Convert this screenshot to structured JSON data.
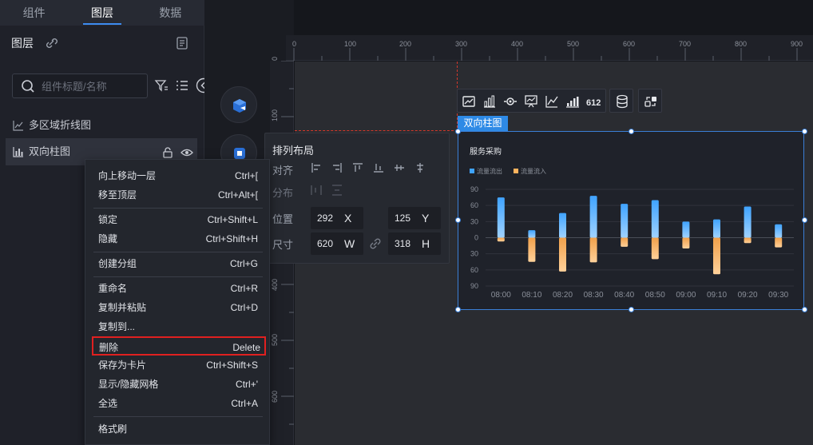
{
  "tabs": [
    "组件",
    "图层",
    "数据"
  ],
  "active_tab": 1,
  "layers_panel": {
    "title": "图层",
    "search_placeholder": "组件标题/名称",
    "items": [
      {
        "label": "多区域折线图",
        "icon": "line-chart-icon",
        "selected": false
      },
      {
        "label": "双向柱图",
        "icon": "bar-chart-icon",
        "selected": true
      }
    ]
  },
  "ruler": {
    "top_ticks": [
      "0",
      "100",
      "200",
      "300",
      "400",
      "500",
      "600",
      "700",
      "800",
      "900"
    ],
    "left_ticks": [
      "0",
      "100",
      "200",
      "300",
      "400",
      "500",
      "600"
    ]
  },
  "arrange_panel": {
    "title": "排列布局",
    "align_label": "对齐",
    "distribute_label": "分布",
    "position_label": "位置",
    "size_label": "尺寸",
    "x_value": "292",
    "x_unit": "X",
    "y_value": "125",
    "y_unit": "Y",
    "w_value": "620",
    "w_unit": "W",
    "h_value": "318",
    "h_unit": "H"
  },
  "context_menu": [
    {
      "label": "向上移动一层",
      "shortcut": "Ctrl+["
    },
    {
      "label": "移至顶层",
      "shortcut": "Ctrl+Alt+["
    },
    {
      "label": "锁定",
      "shortcut": "Ctrl+Shift+L"
    },
    {
      "label": "隐藏",
      "shortcut": "Ctrl+Shift+H"
    },
    {
      "label": "创建分组",
      "shortcut": "Ctrl+G"
    },
    {
      "label": "重命名",
      "shortcut": "Ctrl+R"
    },
    {
      "label": "复制并粘贴",
      "shortcut": "Ctrl+D"
    },
    {
      "label": "复制到...",
      "shortcut": ""
    },
    {
      "label": "删除",
      "shortcut": "Delete"
    },
    {
      "label": "保存为卡片",
      "shortcut": "Ctrl+Shift+S"
    },
    {
      "label": "显示/隐藏网格",
      "shortcut": "Ctrl+'"
    },
    {
      "label": "全选",
      "shortcut": "Ctrl+A"
    },
    {
      "label": "格式刷",
      "shortcut": ""
    }
  ],
  "chart_widget": {
    "tag": "双向柱图"
  },
  "chart_data": {
    "type": "bar",
    "title": "服务采购",
    "categories": [
      "08:00",
      "08:10",
      "08:20",
      "08:30",
      "08:40",
      "08:50",
      "09:00",
      "09:10",
      "09:20",
      "09:30"
    ],
    "series": [
      {
        "name": "流量流出",
        "values": [
          75,
          14,
          46,
          78,
          63,
          70,
          30,
          34,
          58,
          25
        ],
        "color": "#3fa3ff",
        "direction": "up"
      },
      {
        "name": "流量流入",
        "values": [
          7,
          45,
          63,
          46,
          17,
          40,
          20,
          68,
          10,
          18
        ],
        "color": "#ffb35e",
        "direction": "down"
      }
    ],
    "y_ticks": [
      "90",
      "60",
      "30",
      "0",
      "30",
      "60",
      "90"
    ],
    "ylim": [
      -90,
      90
    ],
    "legend": "top-left",
    "grid": true
  },
  "colors": {
    "accent": "#3d8bf0",
    "highlight_border": "#e02020",
    "guide": "#d0372b"
  }
}
